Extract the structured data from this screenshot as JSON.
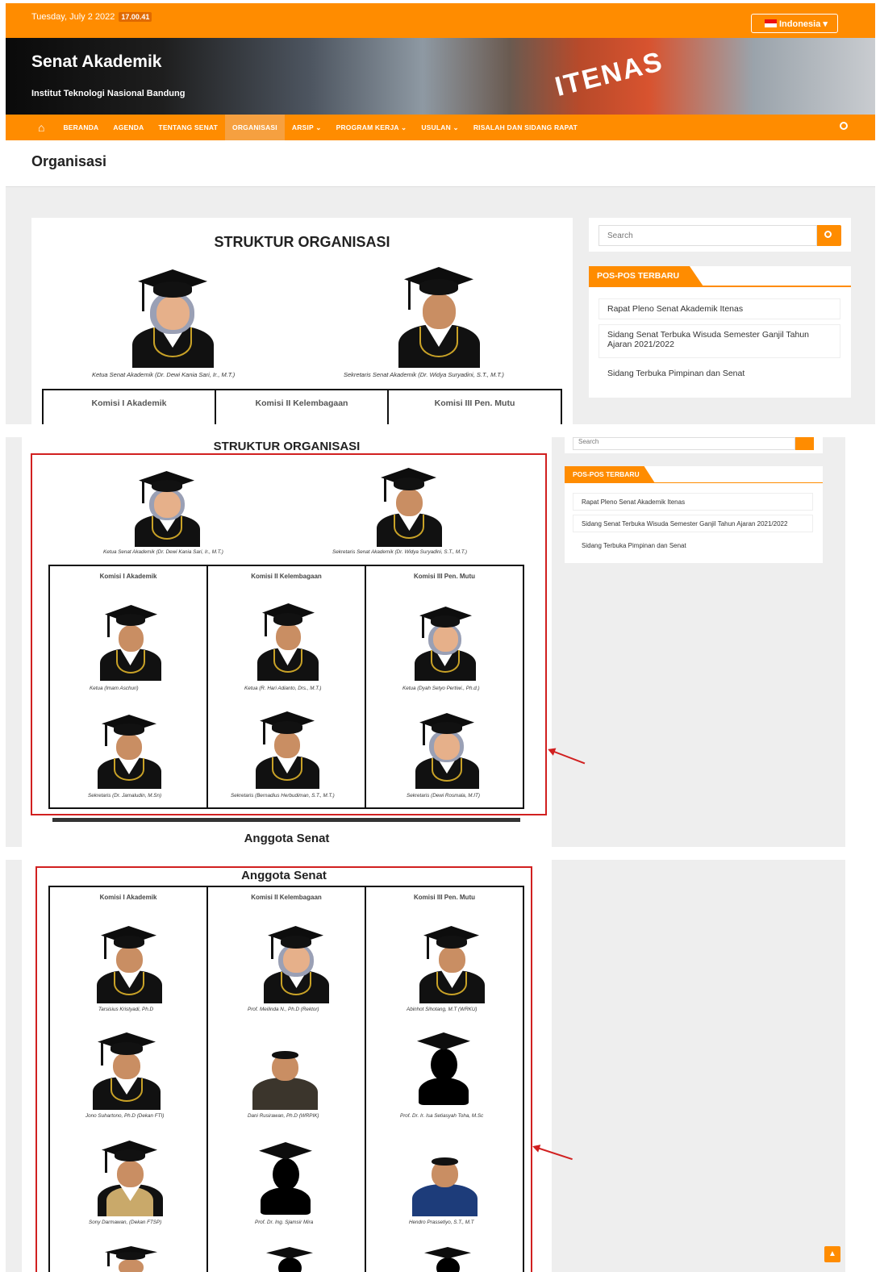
{
  "topbar": {
    "date": "Tuesday, July 2 2022",
    "time": "17.00.41",
    "language": "Indonesia ▾"
  },
  "header": {
    "site_title": "Senat Akademik",
    "site_subtitle": "Institut Teknologi Nasional Bandung",
    "banner_sign": "ITENAS"
  },
  "nav": {
    "items": [
      "BERANDA",
      "AGENDA",
      "TENTANG SENAT",
      "ORGANISASI",
      "ARSIP ⌄",
      "PROGRAM KERJA ⌄",
      "USULAN ⌄",
      "RISALAH DAN SIDANG RAPAT"
    ],
    "active": "ORGANISASI"
  },
  "page": {
    "title": "Organisasi"
  },
  "content": {
    "heading": "STRUKTUR ORGANISASI",
    "leaders": [
      {
        "caption": "Ketua Senat Akademik (Dr. Dewi Kania Sari, Ir., M.T.)"
      },
      {
        "caption": "Sekretaris Senat Akademik (Dr. Widya Suryadini, S.T., M.T.)"
      }
    ],
    "commissions": [
      "Komisi I Akademik",
      "Komisi II Kelembagaan",
      "Komisi III Pen. Mutu"
    ],
    "commission_members": [
      [
        "Ketua (Imam Aschuri)",
        "Sekretaris (Dr. Jamaludin, M.Sn)"
      ],
      [
        "Ketua (R. Hari Adianto, Drs., M.T.)",
        "Sekretaris (Bernadius Herbudiman, S.T., M.T.)"
      ],
      [
        "Ketua (Dyah Setyo Pertiwi., Ph.d.)",
        "Sekretaris (Dewi Rosmala, M.IT)"
      ]
    ],
    "members_heading": "Anggota Senat",
    "members": [
      [
        "Tarsisius Kristyadi, Ph.D",
        "Jono Suhartono, Ph.D (Dekan FTI)",
        "Sony Darmawan, (Dekan FTSP)"
      ],
      [
        "Prof. Meilinda N., Ph.D (Rektor)",
        "Dani Rusirawan, Ph.D (WRPIK)",
        "Prof. Dr. Ing. Sjamsir Mira"
      ],
      [
        "Abinhot Sihotang, M.T (WRKU)",
        "Prof. Dr. Ir. Isa Setiasyah Toha, M.Sc",
        "Hendro Prassetiyo, S.T., M.T"
      ]
    ]
  },
  "sidebar": {
    "search_placeholder": "Search",
    "recent_heading": "POS-POS TERBARU",
    "posts": [
      "Rapat Pleno Senat Akademik Itenas",
      "Sidang Senat Terbuka Wisuda Semester Ganjil Tahun Ajaran 2021/2022",
      "Sidang Terbuka Pimpinan dan Senat"
    ]
  },
  "colors": {
    "accent": "#ff8c00",
    "highlight": "#d12020"
  },
  "icons": [
    "home-icon",
    "search-icon",
    "chevron-up-icon",
    "flag-icon"
  ]
}
